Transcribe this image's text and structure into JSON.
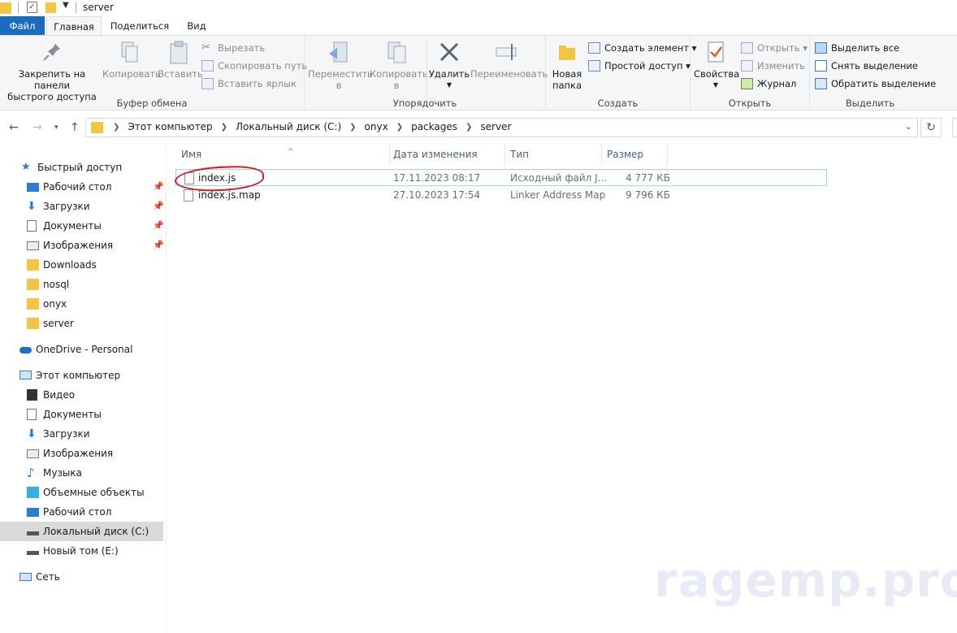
{
  "window": {
    "title": "server"
  },
  "tabs": {
    "file": "Файл",
    "home": "Главная",
    "share": "Поделиться",
    "view": "Вид"
  },
  "ribbon": {
    "clipboard": {
      "label": "Буфер обмена",
      "pin": "Закрепить на панели\nбыстрого доступа",
      "copy": "Копировать",
      "paste": "Вставить",
      "cut": "Вырезать",
      "copy_path": "Скопировать путь",
      "paste_shortcut": "Вставить ярлык"
    },
    "organize": {
      "label": "Упорядочить",
      "move": "Переместить\nв",
      "copy_to": "Копировать\nв",
      "delete": "Удалить",
      "rename": "Переименовать"
    },
    "create": {
      "label": "Создать",
      "new_folder": "Новая\nпапка",
      "new_item": "Создать элемент",
      "easy_access": "Простой доступ"
    },
    "open": {
      "label": "Открыть",
      "properties": "Свойства",
      "open": "Открыть",
      "edit": "Изменить",
      "history": "Журнал"
    },
    "select": {
      "label": "Выделить",
      "select_all": "Выделить все",
      "select_none": "Снять выделение",
      "invert": "Обратить выделение"
    }
  },
  "address": {
    "crumbs": [
      "Этот компьютер",
      "Локальный диск (C:)",
      "onyx",
      "packages",
      "server"
    ]
  },
  "sidebar": {
    "quick_access": "Быстрый доступ",
    "quick_items": [
      "Рабочий стол",
      "Загрузки",
      "Документы",
      "Изображения",
      "Downloads",
      "nosql",
      "onyx",
      "server"
    ],
    "onedrive": "OneDrive - Personal",
    "this_pc": "Этот компьютер",
    "pc_items": [
      "Видео",
      "Документы",
      "Загрузки",
      "Изображения",
      "Музыка",
      "Объемные объекты",
      "Рабочий стол",
      "Локальный диск (C:)",
      "Новый том (E:)"
    ],
    "network": "Сеть"
  },
  "columns": {
    "name": "Имя",
    "date": "Дата изменения",
    "type": "Тип",
    "size": "Размер"
  },
  "files": [
    {
      "name": "index.js",
      "date": "17.11.2023 08:17",
      "type": "Исходный файл J...",
      "size": "4 777 КБ"
    },
    {
      "name": "index.js.map",
      "date": "27.10.2023 17:54",
      "type": "Linker Address Map",
      "size": "9 796 КБ"
    }
  ],
  "watermark": "ragemp.pro",
  "colors": {
    "accent": "#1a6cc1",
    "selection_border": "#99d1ff",
    "annotation": "#e0141f",
    "folder": "#f4c542"
  }
}
